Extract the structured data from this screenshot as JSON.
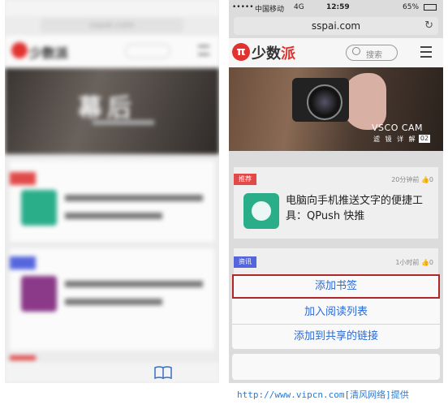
{
  "left_pane": {
    "url": "sspai.com",
    "hero_title": "幕后"
  },
  "right_pane": {
    "status": {
      "carrier": "中国移动",
      "network": "4G",
      "time": "12:59",
      "battery": "65%"
    },
    "url": "sspai.com",
    "logo_text": "少数",
    "logo_accent": "派",
    "search_placeholder": "搜索",
    "hero": {
      "title": "VSCO CAM",
      "subtitle": "滤 镜 详 解",
      "number": "02"
    },
    "cards": [
      {
        "tag": "推荐",
        "tag_color": "#e24a4a",
        "meta": "20分钟前 👍0",
        "title": "电脑向手机推送文字的便捷工具：QPush 快推"
      },
      {
        "tag": "资讯",
        "tag_color": "#5566dd",
        "meta": "1小时前 👍0"
      }
    ],
    "action_sheet": {
      "items": [
        "添加书签",
        "加入阅读列表",
        "添加到共享的链接"
      ]
    }
  },
  "watermark": "http://www.vipcn.com[清风网络]提供"
}
